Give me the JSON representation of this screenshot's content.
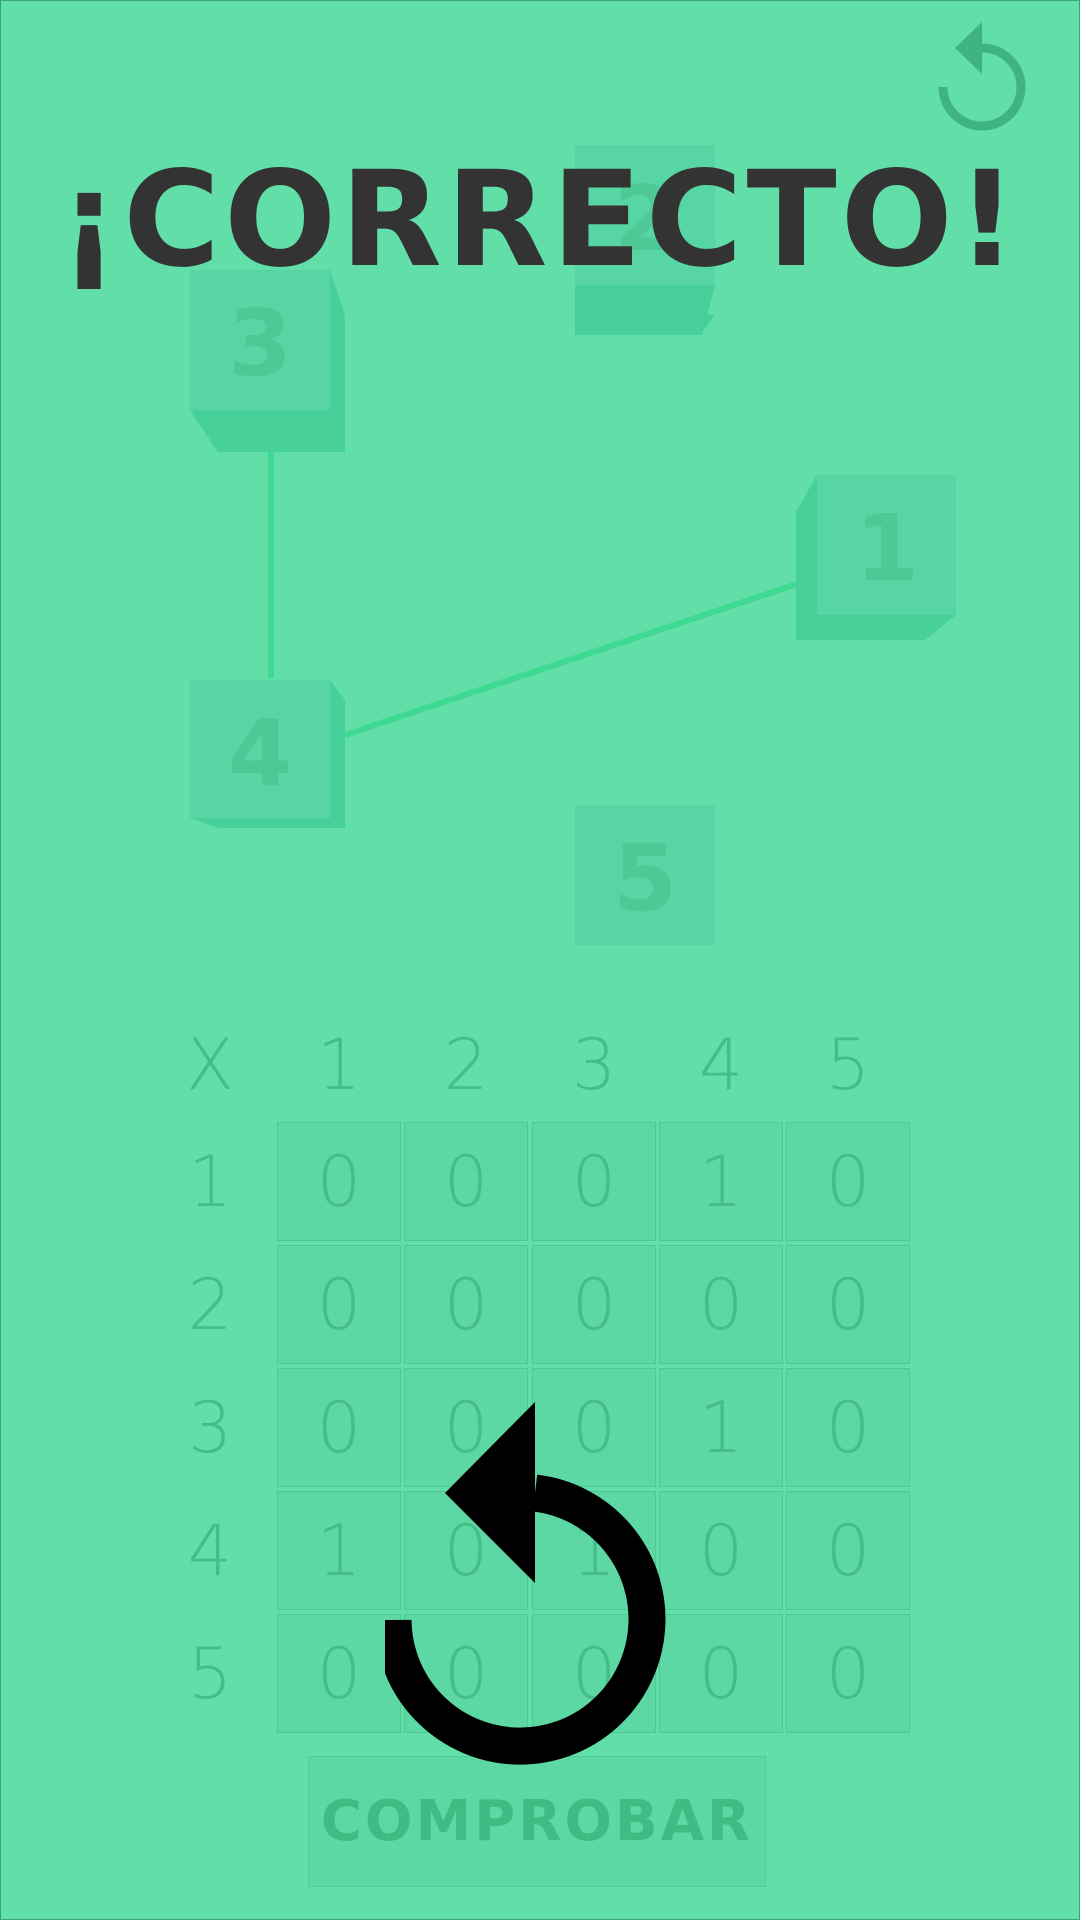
{
  "title": "¡CORRECTO!",
  "colors": {
    "background": "#62dea8",
    "title": "#333333",
    "node_face": "#55d5a3",
    "node_side": "#45cf98",
    "edge": "#3fd992",
    "table_text": "#46bd89",
    "overlay_icon": "#000000"
  },
  "nodes": [
    {
      "label": "3"
    },
    {
      "label": "2"
    },
    {
      "label": "1"
    },
    {
      "label": "4"
    },
    {
      "label": "5"
    }
  ],
  "matrix": {
    "corner": "X",
    "col_headers": [
      "1",
      "2",
      "3",
      "4",
      "5"
    ],
    "row_headers": [
      "1",
      "2",
      "3",
      "4",
      "5"
    ],
    "rows": [
      [
        "0",
        "0",
        "0",
        "1",
        "0"
      ],
      [
        "0",
        "0",
        "0",
        "0",
        "0"
      ],
      [
        "0",
        "0",
        "0",
        "1",
        "0"
      ],
      [
        "1",
        "0",
        "1",
        "0",
        "0"
      ],
      [
        "0",
        "0",
        "0",
        "0",
        "0"
      ]
    ]
  },
  "check_button": "COMPROBAR",
  "icons": {
    "top_reset": "reset-icon",
    "center_overlay": "undo-icon"
  }
}
